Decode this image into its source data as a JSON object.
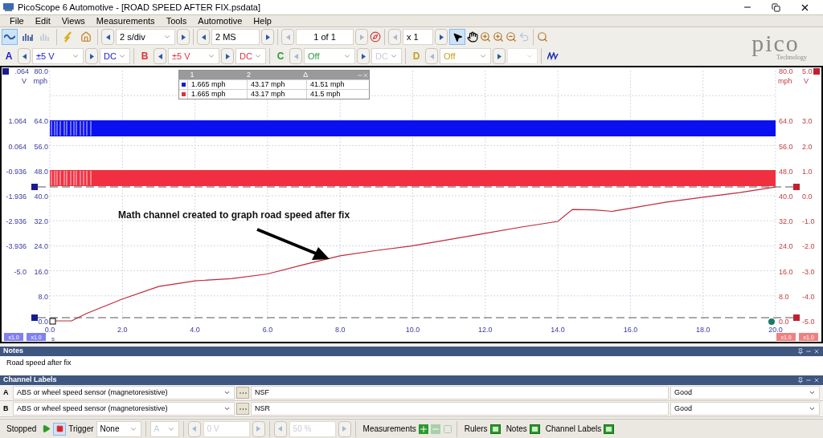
{
  "window": {
    "title": "PicoScope 6 Automotive - [ROAD SPEED AFTER FIX.psdata]"
  },
  "menu": [
    "File",
    "Edit",
    "Views",
    "Measurements",
    "Tools",
    "Automotive",
    "Help"
  ],
  "toolbar": {
    "timebase": "2 s/div",
    "samples": "2 MS",
    "buffer": "1 of 1",
    "zoom": "x 1"
  },
  "channels": [
    {
      "letter": "A",
      "range": "±5 V",
      "coupling": "DC",
      "enabled": true,
      "color": "#1a1ad0"
    },
    {
      "letter": "B",
      "range": "±5 V",
      "coupling": "DC",
      "enabled": true,
      "color": "#e0303a"
    },
    {
      "letter": "C",
      "range": "Off",
      "coupling": "DC",
      "enabled": false,
      "color": "#2a9a3a"
    },
    {
      "letter": "D",
      "range": "Off",
      "enabled": false,
      "color": "#c8a020"
    }
  ],
  "logo": {
    "name": "pico",
    "tagline": "Technology"
  },
  "scope": {
    "left_units": [
      "V",
      "mph"
    ],
    "right_units": [
      "mph",
      "V"
    ],
    "left_volt_labels": [
      ".064",
      "1.064",
      "0.064",
      "-0.936",
      "-1.936",
      "-2.936",
      "-3.936",
      "-5.0"
    ],
    "right_mph_labels": [
      "80.0",
      "64.0",
      "56.0",
      "48.0",
      "40.0",
      "32.0",
      "24.0",
      "16.0",
      "8.0",
      "0.0"
    ],
    "right_volt_labels": [
      "5.0",
      "3.0",
      "2.0",
      "1.0",
      "0.0",
      "-1.0",
      "-2.0",
      "-3.0",
      "-4.0",
      "-5.0"
    ],
    "left_badges": [
      "x1.0",
      "x1.0"
    ],
    "right_badges": [
      "x1.0",
      "x1.0"
    ],
    "annotation": "Math channel created to graph road speed after fix",
    "chart_data": {
      "type": "line",
      "xlabel": "s",
      "xlim": [
        0,
        20
      ],
      "ylim": [
        0,
        80
      ],
      "grid": true,
      "xticks": [
        {
          "value": 0,
          "label": "0.0"
        },
        {
          "value": 2,
          "label": "2.0"
        },
        {
          "value": 4,
          "label": "4.0"
        },
        {
          "value": 6,
          "label": "6.0"
        },
        {
          "value": 8,
          "label": "8.0"
        },
        {
          "value": 10,
          "label": "10.0"
        },
        {
          "value": 12,
          "label": "12.0"
        },
        {
          "value": 14,
          "label": "14.0"
        },
        {
          "value": 16,
          "label": "16.0"
        },
        {
          "value": 18,
          "label": "18.0"
        },
        {
          "value": 20,
          "label": "20.0"
        }
      ],
      "yticks": [
        {
          "value": 80,
          "label": "80.0"
        },
        {
          "value": 64,
          "label": "64.0"
        },
        {
          "value": 56,
          "label": "56.0"
        },
        {
          "value": 48,
          "label": "48.0"
        },
        {
          "value": 40,
          "label": "40.0"
        },
        {
          "value": 32,
          "label": "32.0"
        },
        {
          "value": 24,
          "label": "24.0"
        },
        {
          "value": 16,
          "label": "16.0"
        },
        {
          "value": 8,
          "label": "8.0"
        },
        {
          "value": 0,
          "label": "0.0"
        }
      ],
      "x": [
        0,
        0.6,
        1,
        2,
        3,
        4,
        5,
        6,
        7,
        8,
        9,
        10,
        11,
        12,
        13,
        14,
        14.4,
        15,
        15.5,
        16,
        17,
        18,
        19,
        20
      ],
      "series": [
        {
          "color": "#c0283a",
          "values": [
            0,
            0,
            2.3,
            7,
            11,
            12.8,
            13.5,
            15,
            18,
            20.8,
            22.5,
            24,
            26,
            28,
            30,
            31.8,
            35.6,
            35.5,
            35,
            36,
            38,
            39.5,
            41,
            42.8
          ]
        }
      ]
    }
  },
  "cursor_table": {
    "columns": [
      "1",
      "2",
      "Δ"
    ],
    "rows": [
      {
        "color": "#1a1ad0",
        "values": [
          "1.665 mph",
          "43.17 mph",
          "41.51 mph"
        ]
      },
      {
        "color": "#e0303a",
        "values": [
          "1.665 mph",
          "43.17 mph",
          "41.5 mph"
        ]
      }
    ]
  },
  "notes": {
    "title": "Notes",
    "text": "Road speed after fix"
  },
  "channel_labels": {
    "title": "Channel Labels",
    "rows": [
      {
        "letter": "A",
        "probe": "ABS or wheel speed sensor (magnetoresistive)",
        "label": "NSF",
        "status": "Good"
      },
      {
        "letter": "B",
        "probe": "ABS or wheel speed sensor (magnetoresistive)",
        "label": "NSR",
        "status": "Good"
      }
    ]
  },
  "status_bar": {
    "state": "Stopped",
    "trigger_label": "Trigger",
    "trigger_mode": "None",
    "trigger_source": "A",
    "threshold": "0 V",
    "pretrigger": "50 %",
    "toggles": [
      {
        "label": "Measurements",
        "kind": "add"
      },
      {
        "label": "Rulers",
        "kind": "show"
      },
      {
        "label": "Notes",
        "kind": "show"
      },
      {
        "label": "Channel Labels",
        "kind": "show"
      }
    ]
  }
}
